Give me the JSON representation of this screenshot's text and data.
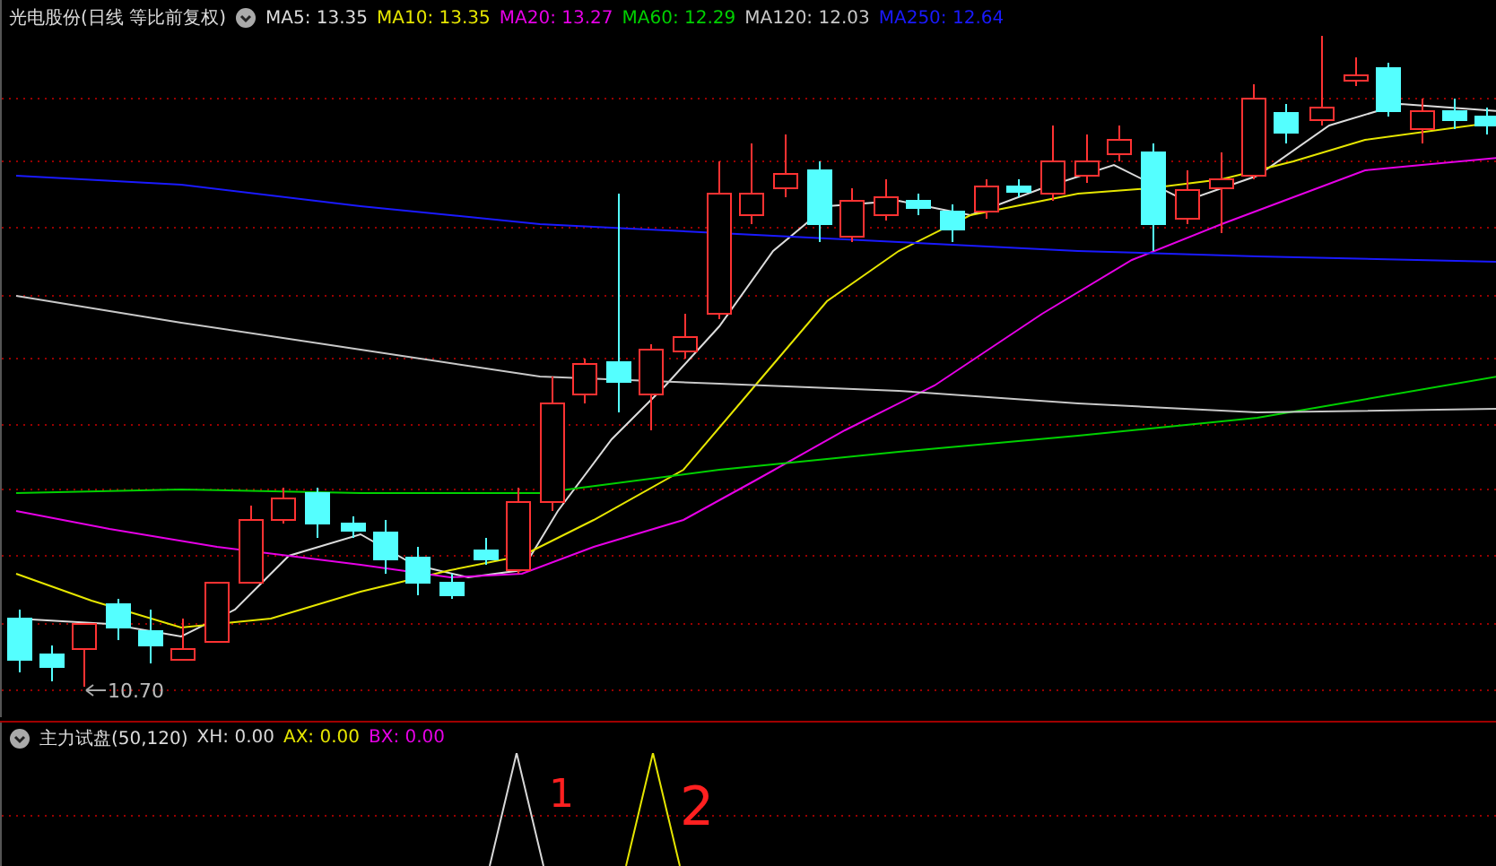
{
  "main_chart": {
    "title": "光电股份(日线 等比前复权)",
    "legend": [
      {
        "label": "MA5: 13.35",
        "color": "#dcdcdc"
      },
      {
        "label": "MA10: 13.35",
        "color": "#e6e600"
      },
      {
        "label": "MA20: 13.27",
        "color": "#e600e6"
      },
      {
        "label": "MA60: 12.29",
        "color": "#00d000"
      },
      {
        "label": "MA120: 12.03",
        "color": "#c8c8c8"
      },
      {
        "label": "MA250: 12.64",
        "color": "#1a1aff"
      }
    ],
    "low_label": "10.70"
  },
  "indicator": {
    "title": "主力试盘(50,120)",
    "legend": [
      {
        "label": "XH: 0.00",
        "color": "#d8d8d8"
      },
      {
        "label": "AX: 0.00",
        "color": "#e6e600"
      },
      {
        "label": "BX: 0.00",
        "color": "#e600e6"
      }
    ],
    "annotations": [
      "1",
      "2"
    ]
  }
}
